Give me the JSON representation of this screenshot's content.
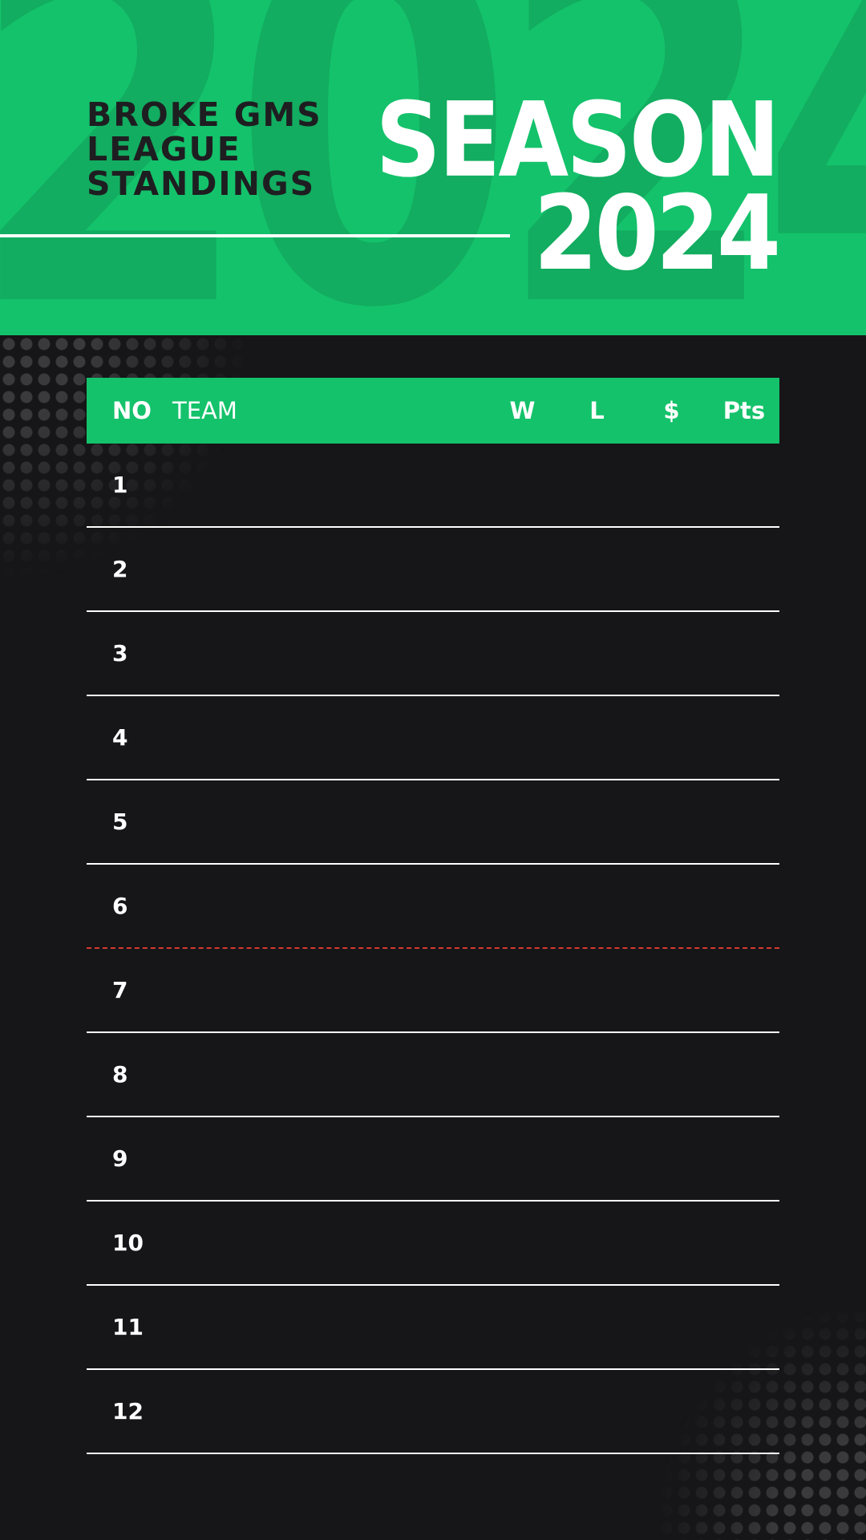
{
  "header": {
    "background_year": "2024",
    "title_lines": [
      "BROKE GMS",
      "LEAGUE",
      "STANDINGS"
    ],
    "season_word": "SEASON",
    "season_year": "2024"
  },
  "table": {
    "columns": {
      "no": "NO",
      "team": "TEAM",
      "w": "W",
      "l": "L",
      "money": "$",
      "pts": "Pts"
    },
    "rows": [
      "1",
      "2",
      "3",
      "4",
      "5",
      "6",
      "7",
      "8",
      "9",
      "10",
      "11",
      "12"
    ],
    "cutoff_after_row": 6
  },
  "colors": {
    "accent_green": "#14c26b",
    "background": "#161518",
    "cutoff_line": "#d63b2f",
    "text_light": "#ffffff",
    "text_dark": "#1e1e21"
  }
}
